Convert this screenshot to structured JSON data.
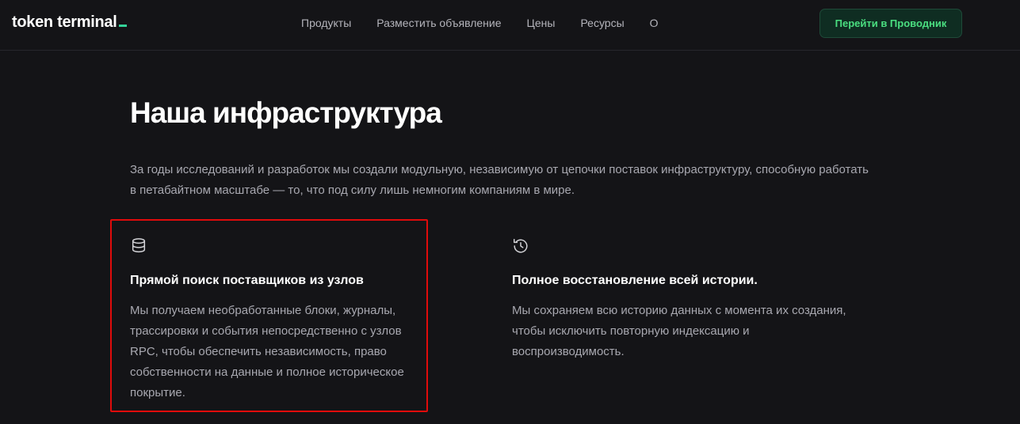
{
  "header": {
    "logo_text": "token terminal",
    "nav": [
      "Продукты",
      "Разместить объявление",
      "Цены",
      "Ресурсы",
      "О"
    ],
    "cta_label": "Перейти в Проводник"
  },
  "main": {
    "title": "Наша инфраструктура",
    "intro": "За годы исследований и разработок мы создали модульную, независимую от цепочки поставок инфраструктуру, способную работать в петабайтном масштабе — то, что под силу лишь немногим компаниям в мире.",
    "features": [
      {
        "icon": "database-icon",
        "title": "Прямой поиск поставщиков из узлов",
        "text": "Мы получаем необработанные блоки, журналы, трассировки и события непосредственно с узлов RPC, чтобы обеспечить независимость, право собственности на данные и полное историческое покрытие."
      },
      {
        "icon": "history-icon",
        "title": "Полное восстановление всей истории.",
        "text": "Мы сохраняем всю историю данных с момента их создания, чтобы исключить повторную индексацию и воспроизводимость."
      }
    ]
  },
  "colors": {
    "background": "#141417",
    "accent": "#4ade80",
    "highlight": "#e00b0b"
  }
}
